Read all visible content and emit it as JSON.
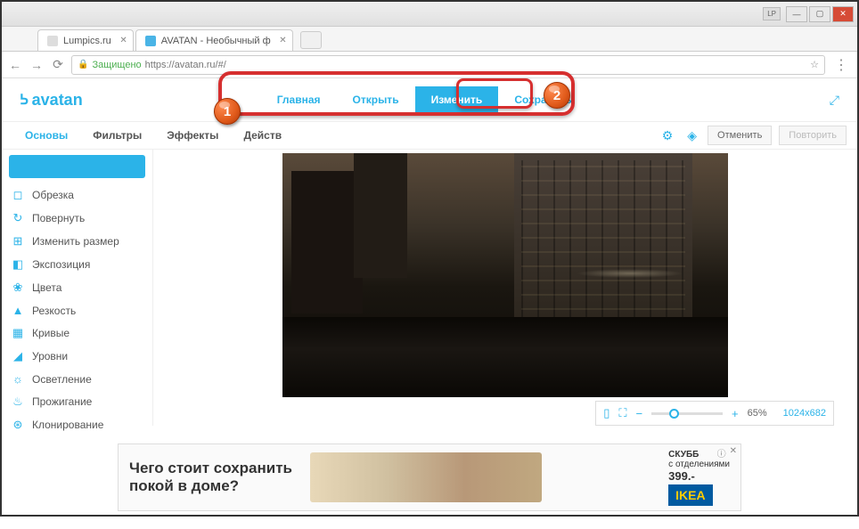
{
  "window": {
    "lp": "LP"
  },
  "tabs": [
    {
      "title": "Lumpics.ru",
      "favClass": ""
    },
    {
      "title": "AVATAN - Необычный ф",
      "favClass": "blue"
    }
  ],
  "address": {
    "secure": "Защищено",
    "url_prefix": "https://",
    "url_rest": "avatan.ru/#/"
  },
  "logo": "avatan",
  "mainNav": {
    "home": "Главная",
    "open": "Открыть",
    "edit": "Изменить",
    "save": "Сохранить"
  },
  "subNav": {
    "basics": "Основы",
    "filters": "Фильтры",
    "effects": "Эффекты",
    "actions": "Действ",
    "undo": "Отменить",
    "redo": "Повторить"
  },
  "sidebar": [
    {
      "icon": "◻",
      "label": "Обрезка"
    },
    {
      "icon": "↻",
      "label": "Повернуть"
    },
    {
      "icon": "⊞",
      "label": "Изменить размер"
    },
    {
      "icon": "◧",
      "label": "Экспозиция"
    },
    {
      "icon": "❀",
      "label": "Цвета"
    },
    {
      "icon": "▲",
      "label": "Резкость"
    },
    {
      "icon": "▦",
      "label": "Кривые"
    },
    {
      "icon": "◢",
      "label": "Уровни"
    },
    {
      "icon": "☼",
      "label": "Осветление"
    },
    {
      "icon": "♨",
      "label": "Прожигание"
    },
    {
      "icon": "⊛",
      "label": "Клонирование"
    }
  ],
  "zoom": {
    "percent": "65%",
    "dimensions": "1024x682"
  },
  "ad": {
    "line1": "Чего стоит сохранить",
    "line2": "покой в доме?",
    "product": "СКУББ",
    "desc": "с отделениями",
    "price": "399.-",
    "brand": "IKEA"
  },
  "markers": {
    "one": "1",
    "two": "2"
  }
}
